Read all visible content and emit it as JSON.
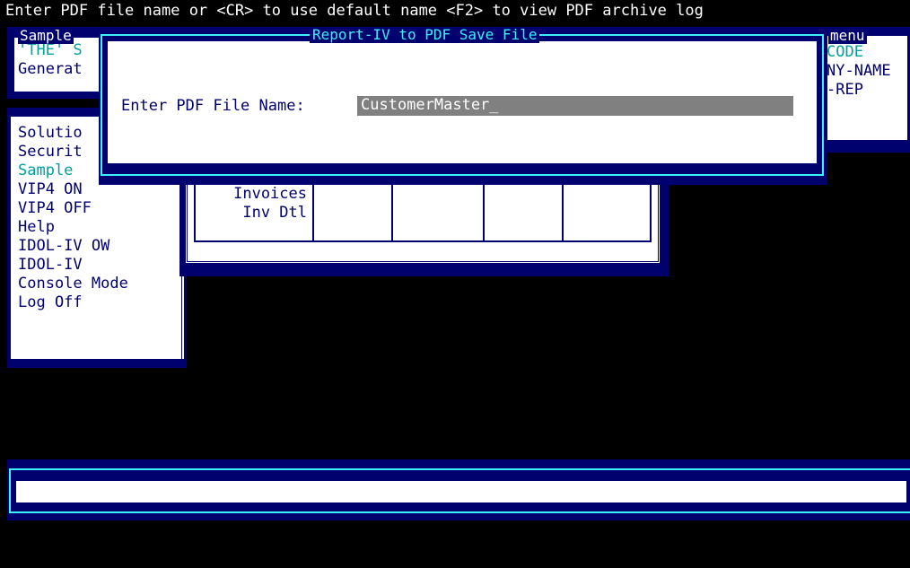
{
  "status_line": "Enter PDF file name or <CR> to use default name <F2> to view PDF archive log",
  "sample_panel": {
    "title": "Sample",
    "lines": [
      "'THE' S",
      "Generat"
    ]
  },
  "menu_panel": {
    "title": "menu",
    "lines": [
      "CODE",
      "NY-NAME",
      "-REP"
    ]
  },
  "main_menu": {
    "items": [
      {
        "label": "Solutio",
        "color": "navy"
      },
      {
        "label": "Securit",
        "color": "navy"
      },
      {
        "label": "Sample",
        "color": "cyan"
      },
      {
        "label": "VIP4 ON",
        "color": "navy"
      },
      {
        "label": "VIP4 OFF",
        "color": "navy"
      },
      {
        "label": "Help",
        "color": "navy"
      },
      {
        "label": "IDOL-IV OW",
        "color": "navy"
      },
      {
        "label": "IDOL-IV",
        "color": "navy"
      },
      {
        "label": "Console Mode",
        "color": "navy"
      },
      {
        "label": "Log Off",
        "color": "navy"
      }
    ]
  },
  "grid": {
    "rows": [
      "Invoices",
      "Inv Dtl"
    ]
  },
  "dialog": {
    "title": "Report-IV to PDF Save File",
    "prompt": "Enter PDF File Name:",
    "filename": "CustomerMaster_"
  },
  "command_line": "",
  "colors": {
    "navy": "#00006e",
    "cyan_text": "#00a0a0",
    "dialog_title": "#3cf0ff",
    "field_bg": "#808080"
  }
}
